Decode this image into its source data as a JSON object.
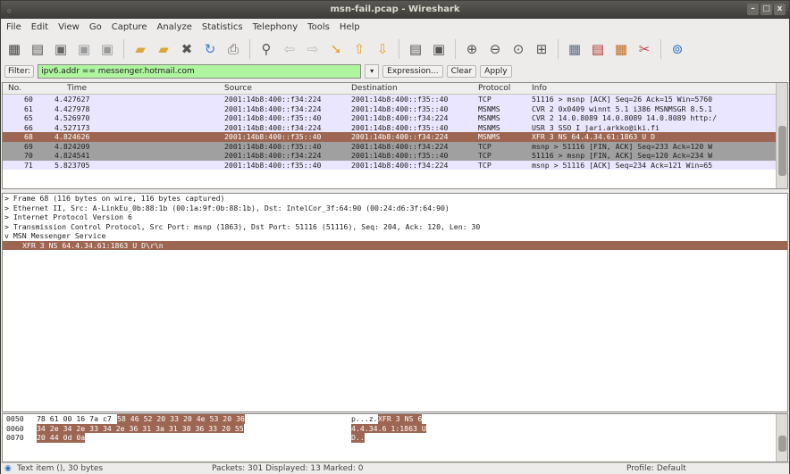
{
  "window": {
    "title": "msn-fail.pcap - Wireshark",
    "controls": [
      "–",
      "□",
      "x"
    ]
  },
  "menu": [
    "File",
    "Edit",
    "View",
    "Go",
    "Capture",
    "Analyze",
    "Statistics",
    "Telephony",
    "Tools",
    "Help"
  ],
  "toolbar_icons": [
    "interfaces-icon",
    "options-icon",
    "start-icon",
    "stop-icon",
    "restart-icon",
    "open-icon",
    "save-icon",
    "close-icon",
    "reload-icon",
    "print-icon",
    "find-icon",
    "back-icon",
    "forward-icon",
    "goto-icon",
    "first-icon",
    "last-icon",
    "colorize-icon",
    "autoscroll-icon",
    "zoom-in-icon",
    "zoom-out-icon",
    "zoom-normal-icon",
    "resize-columns-icon",
    "capture-filters-icon",
    "display-filters-icon",
    "coloring-rules-icon",
    "preferences-icon",
    "help-icon"
  ],
  "filter": {
    "label": "Filter:",
    "value": "ipv6.addr == messenger.hotmail.com",
    "expression": "Expression...",
    "clear": "Clear",
    "apply": "Apply"
  },
  "packet_list": {
    "headers": [
      "No.",
      "Time",
      "Source",
      "Destination",
      "Protocol",
      "Info"
    ],
    "rows": [
      {
        "no": "60",
        "time": "4.427627",
        "src": "2001:14b8:400::f34:224",
        "dst": "2001:14b8:400::f35::40",
        "proto": "TCP",
        "info": "51116 > msnp [ACK] Seq=26 Ack=15 Win=5760",
        "bg": "#ebe6ff",
        "fg": "#222"
      },
      {
        "no": "61",
        "time": "4.427978",
        "src": "2001:14b8:400::f34:224",
        "dst": "2001:14b8:400::f35::40",
        "proto": "MSNMS",
        "info": "CVR 2 0x0409 winnt 5.1 i386 MSNMSGR 8.5.1",
        "bg": "#ebe6ff",
        "fg": "#222"
      },
      {
        "no": "65",
        "time": "4.526970",
        "src": "2001:14b8:400::f35::40",
        "dst": "2001:14b8:400::f34:224",
        "proto": "MSNMS",
        "info": "CVR 2 14.0.8089 14.0.8089 14.0.8089 http:/",
        "bg": "#ebe6ff",
        "fg": "#222"
      },
      {
        "no": "66",
        "time": "4.527173",
        "src": "2001:14b8:400::f34:224",
        "dst": "2001:14b8:400::f35::40",
        "proto": "MSNMS",
        "info": "USR 3 SSO I jari.arkko@iki.fi",
        "bg": "#ebe6ff",
        "fg": "#222"
      },
      {
        "no": "68",
        "time": "4.824626",
        "src": "2001:14b8:400::f35::40",
        "dst": "2001:14b8:400::f34:224",
        "proto": "MSNMS",
        "info": "XFR 3 NS 64.4.34.61:1863 U D",
        "bg": "#9c6652",
        "fg": "#fff"
      },
      {
        "no": "69",
        "time": "4.824209",
        "src": "2001:14b8:400::f35::40",
        "dst": "2001:14b8:400::f34:224",
        "proto": "TCP",
        "info": "msnp > 51116 [FIN, ACK] Seq=233 Ack=120 W",
        "bg": "#a0a0a0",
        "fg": "#222"
      },
      {
        "no": "70",
        "time": "4.824541",
        "src": "2001:14b8:400::f34:224",
        "dst": "2001:14b8:400::f35::40",
        "proto": "TCP",
        "info": "51116 > msnp [FIN, ACK] Seq=120 Ack=234 W",
        "bg": "#a0a0a0",
        "fg": "#222"
      },
      {
        "no": "71",
        "time": "5.823705",
        "src": "2001:14b8:400::f35::40",
        "dst": "2001:14b8:400::f34:224",
        "proto": "TCP",
        "info": "msnp > 51116 [ACK] Seq=234 Ack=121 Win=65",
        "bg": "#ebe6ff",
        "fg": "#222"
      }
    ]
  },
  "details": [
    {
      "text": "> Frame 68 (116 bytes on wire, 116 bytes captured)"
    },
    {
      "text": "> Ethernet II, Src: A-LinkEu_0b:88:1b (00:1a:9f:0b:88:1b), Dst: IntelCor_3f:64:90 (00:24:d6:3f:64:90)"
    },
    {
      "text": "> Internet Protocol Version 6"
    },
    {
      "text": "> Transmission Control Protocol, Src Port: msnp (1863), Dst Port: 51116 (51116), Seq: 204, Ack: 120, Len: 30"
    },
    {
      "text": "v MSN Messenger Service"
    }
  ],
  "selected_detail": "XFR 3 NS 64.4.34.61:1863 U D\\r\\n",
  "hex": [
    {
      "off": "0050",
      "pre": "78 61 00 16 7a c7 ",
      "hl": "58 46 52 20 33 20 4e 53 20 36",
      "ascii_pre": "p...z.",
      "ascii_hl": "XFR 3 NS 6"
    },
    {
      "off": "0060",
      "pre": "",
      "hl": "34 2e 34 2e 33 34 2e 36 31 3a 31 38 36 33 20 55",
      "ascii_pre": "",
      "ascii_hl": "4.4.34.6 1:1863 U"
    },
    {
      "off": "0070",
      "pre": "",
      "hl": "20 44 0d 0a",
      "ascii_pre": "",
      "ascii_hl": " D.."
    }
  ],
  "status": {
    "left": "Text item (), 30 bytes",
    "middle": "Packets: 301 Displayed: 13 Marked: 0",
    "right": "Profile: Default"
  }
}
